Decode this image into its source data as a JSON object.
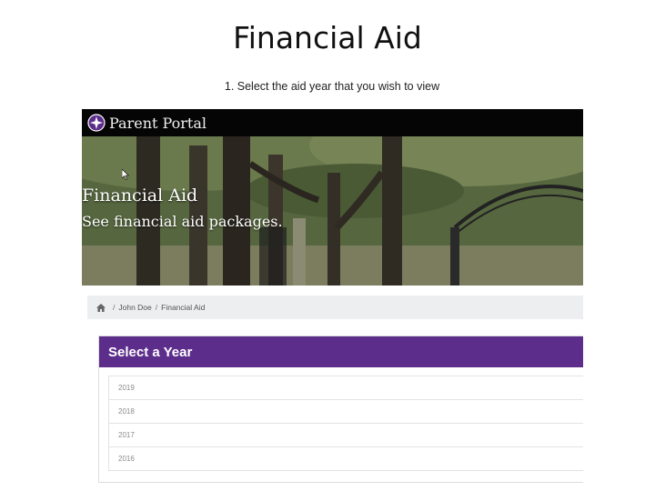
{
  "slide": {
    "title": "Financial Aid",
    "subtitle": "1. Select the aid year that you wish to view"
  },
  "portal": {
    "name": "Parent Portal",
    "hero_title": "Financial Aid",
    "hero_subtitle": "See financial aid packages."
  },
  "breadcrumb": {
    "items": [
      "John Doe",
      "Financial Aid"
    ],
    "separator": "/"
  },
  "year_select": {
    "header": "Select a Year",
    "years": [
      "2019",
      "2018",
      "2017",
      "2016"
    ]
  },
  "colors": {
    "header_purple": "#5d2d8c",
    "portal_bar": "#050505"
  },
  "icons": {
    "logo": "star-seal-icon",
    "home": "home-icon",
    "cursor": "mouse-pointer-icon"
  }
}
